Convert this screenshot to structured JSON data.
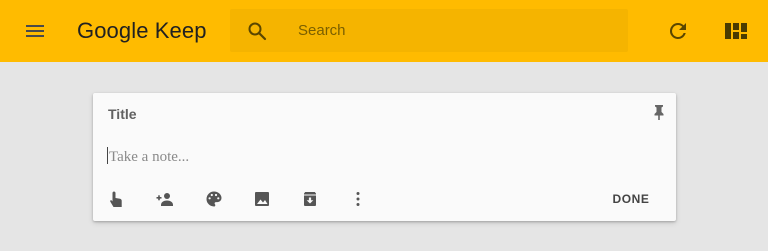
{
  "header": {
    "logo_google": "Google",
    "logo_keep": "Keep",
    "search_placeholder": "Search",
    "icons": [
      "menu-icon",
      "search-icon",
      "refresh-icon",
      "grid-view-icon"
    ],
    "accent_color": "#ffbb00"
  },
  "note": {
    "title_placeholder": "Title",
    "body_placeholder": "Take a note...",
    "done_label": "DONE",
    "toolbar_icons": [
      "remind-me-icon",
      "collaborator-icon",
      "palette-icon",
      "image-icon",
      "archive-icon",
      "more-icon"
    ],
    "pin_icon": "pin-icon"
  }
}
